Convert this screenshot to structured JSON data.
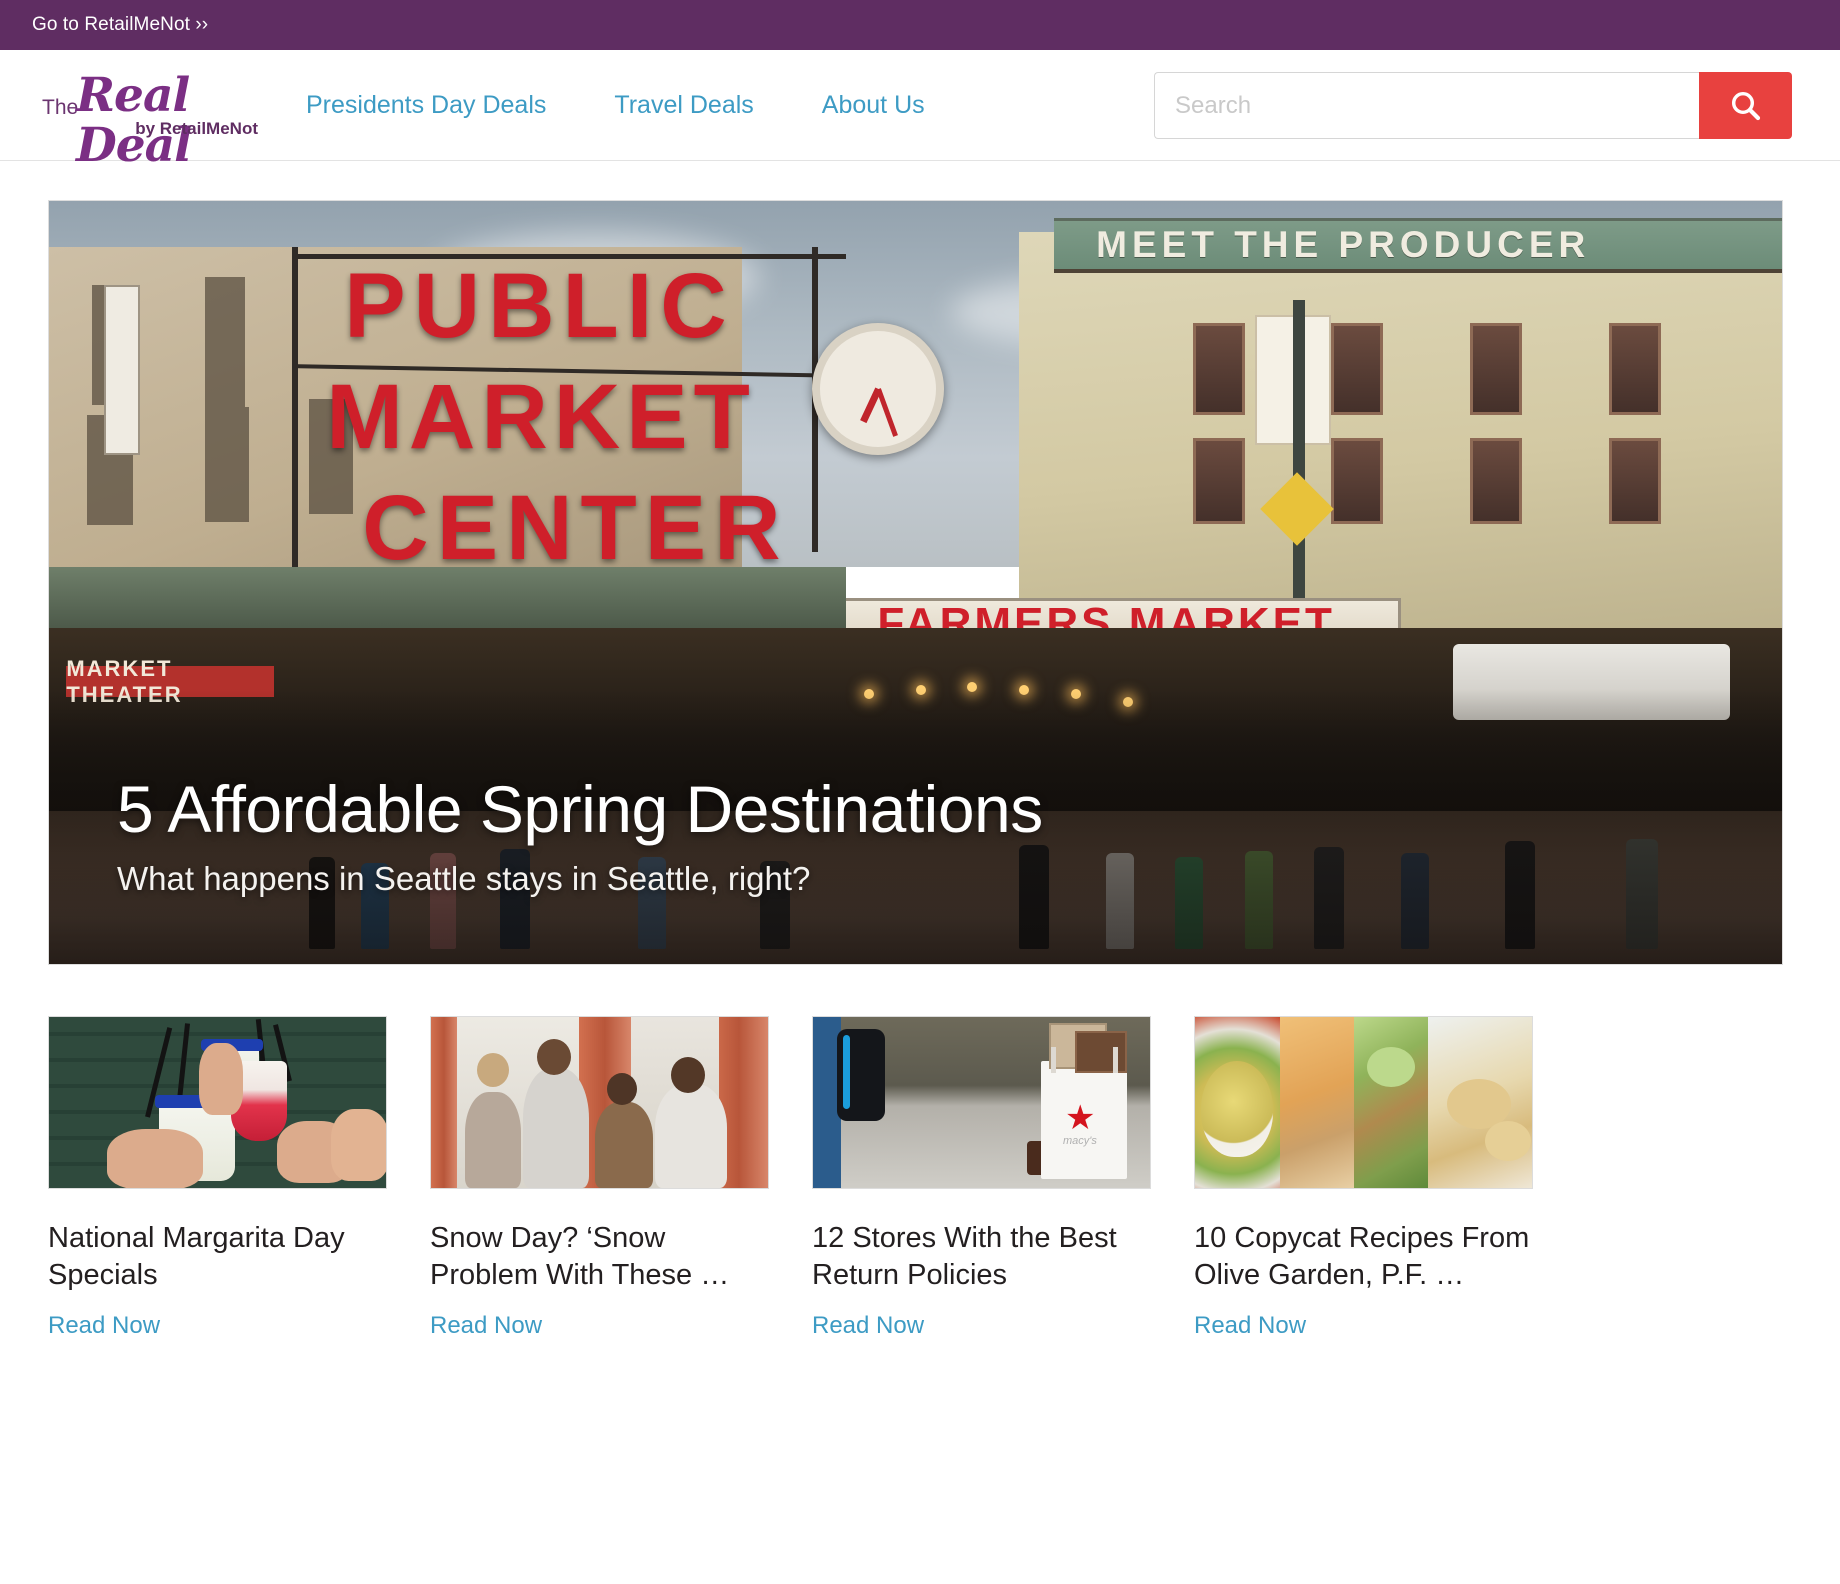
{
  "topbar": {
    "link_label": "Go to RetailMeNot ››"
  },
  "header": {
    "logo": {
      "the": "The",
      "main": "Real Deal",
      "sub": "by RetailMeNot"
    },
    "nav": [
      {
        "label": "Presidents Day Deals"
      },
      {
        "label": "Travel Deals"
      },
      {
        "label": "About Us"
      }
    ],
    "search": {
      "placeholder": "Search",
      "value": "",
      "button_icon": "search-icon"
    }
  },
  "hero": {
    "title": "5 Affordable Spring Destinations",
    "subtitle": "What happens in Seattle stays in Seattle, right?",
    "image_alt": "Pike Place Public Market Center Farmers Market, Seattle",
    "signs": {
      "public": "PUBLIC",
      "market": "MARKET",
      "center": "CENTER",
      "farmers_market": "FARMERS MARKET",
      "meet_the_producer": "MEET THE PRODUCER",
      "market_theater": "MARKET THEATER"
    }
  },
  "cards": [
    {
      "title": "National Margarita Day Specials",
      "read_label": "Read Now",
      "image_alt": "Three people toasting frozen margaritas"
    },
    {
      "title": "Snow Day? ‘Snow Problem With These …",
      "read_label": "Read Now",
      "image_alt": "Four children looking out a window on a snow day"
    },
    {
      "title": "12 Stores With the Best Return Policies",
      "read_label": "Read Now",
      "image_alt": "Shopper carrying a white Macy's tote bag with boxes"
    },
    {
      "title": "10 Copycat Recipes From Olive Garden, P.F. …",
      "read_label": "Read Now",
      "image_alt": "Four panel food collage: soup, fried shrimp, lettuce wraps, biscuits"
    }
  ],
  "colors": {
    "topbar_purple": "#5f2d62",
    "link_blue": "#3d9bc4",
    "search_red": "#e8413f",
    "logo_purple": "#7b2f84",
    "text_dark": "#231f20"
  }
}
